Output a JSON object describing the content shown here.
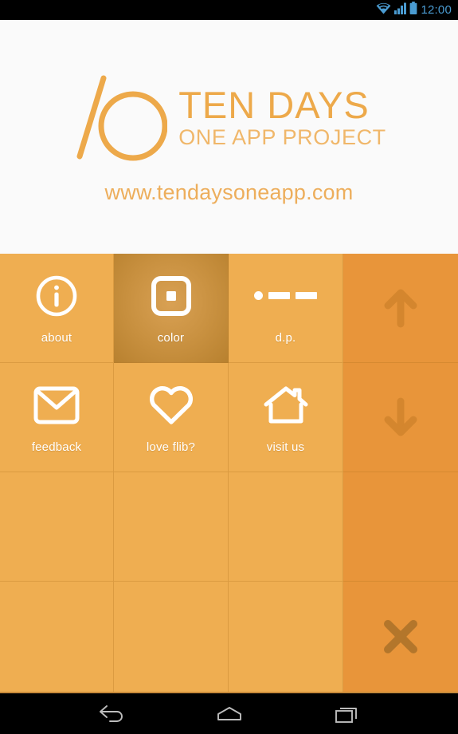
{
  "status_bar": {
    "time": "12:00",
    "icons": [
      "wifi-icon",
      "signal-icon",
      "battery-icon"
    ],
    "accent_color": "#4A9BD1",
    "background": "#000000"
  },
  "header": {
    "logo_number": "10",
    "title": "TEN DAYS",
    "subtitle": "ONE APP PROJECT",
    "url": "www.tendaysoneapp.com",
    "brand_color": "#EDA94A",
    "background": "#FAFAFA"
  },
  "grid": {
    "base_color": "#EFAE51",
    "rail_color": "#E8953A",
    "pressed_color": "#C8903F",
    "columns": 4,
    "rows": 4,
    "tiles": [
      {
        "label": "about",
        "icon": "info-icon",
        "state": "normal"
      },
      {
        "label": "color",
        "icon": "square-icon",
        "state": "pressed"
      },
      {
        "label": "d.p.",
        "icon": "dot-dash-icon",
        "state": "normal"
      },
      {
        "label": "feedback",
        "icon": "envelope-icon",
        "state": "normal"
      },
      {
        "label": "love flib?",
        "icon": "heart-icon",
        "state": "normal"
      },
      {
        "label": "visit us",
        "icon": "house-icon",
        "state": "normal"
      }
    ],
    "rail": [
      {
        "icon": "arrow-up-icon",
        "label": ""
      },
      {
        "icon": "arrow-down-icon",
        "label": ""
      },
      {
        "icon": "",
        "label": ""
      },
      {
        "icon": "close-icon",
        "label": ""
      }
    ]
  },
  "nav_bar": {
    "buttons": [
      "back-icon",
      "home-icon",
      "recents-icon"
    ],
    "background": "#000000"
  }
}
